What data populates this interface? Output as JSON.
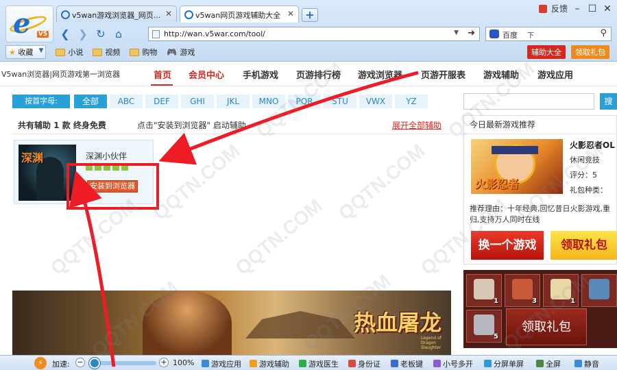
{
  "browser": {
    "tabs": [
      {
        "label": "v5wan游戏浏览器_网页..."
      },
      {
        "label": "v5wan网页游戏辅助大全"
      }
    ],
    "new_tab_label": "+",
    "feedback": "反馈",
    "logo_badge": "V5",
    "address": "http://wan.v5war.com/tool/",
    "search_engine": "百度",
    "favorites_label": "收藏",
    "favorites": [
      {
        "label": "小说"
      },
      {
        "label": "视频"
      },
      {
        "label": "购物"
      },
      {
        "label": "游戏"
      }
    ],
    "helpers_button": "辅助大全",
    "gift_button": "领取礼包"
  },
  "site": {
    "brand": "V5wan浏览器|网页游戏第一浏览器",
    "nav": [
      {
        "label": "首页"
      },
      {
        "label": "会员中心"
      },
      {
        "label": "手机游戏"
      },
      {
        "label": "页游排行榜"
      },
      {
        "label": "游戏浏览器"
      },
      {
        "label": "页游开服表"
      },
      {
        "label": "游戏辅助"
      },
      {
        "label": "游戏应用"
      }
    ],
    "filter_label": "按首字母:",
    "letters": [
      "全部",
      "ABC",
      "DEF",
      "GHI",
      "JKL",
      "MNO",
      "PQR",
      "STU",
      "VWX",
      "YZ"
    ],
    "search_btn": "搜"
  },
  "helper_list": {
    "count_text": "共有辅助 1 款 终身免费",
    "hint_text": "点击\"安装到浏览器\" 启动辅助",
    "expand_link": "展开全部辅助",
    "items": [
      {
        "thumb_title": "深渊",
        "name": "深渊小伙伴",
        "rating": 5,
        "install_label": "安装到浏览器"
      }
    ]
  },
  "banner": {
    "title": "热血屠龙",
    "subtitle": "Legend of Dragon Slaughter"
  },
  "today": {
    "title": "今日最新游戏推荐",
    "game_name": "火影忍者OL",
    "thumb_logo": "火影忍者",
    "genre": "休闲竞技",
    "score": "评分：5",
    "gift": "礼包种类：",
    "reason": "推荐理由：十年经典,回忆昔日火影游戏,重归,支持万人同时在线",
    "btn_another": "换一个游戏",
    "btn_claim": "领取礼包"
  },
  "gift_panel": {
    "slots": [
      {
        "num": "1",
        "color": "#d8c8b8"
      },
      {
        "num": "3",
        "color": "#c85a3a"
      },
      {
        "num": "1",
        "color": "#e8d8a8"
      },
      {
        "num": "",
        "color": "#5a8ab8"
      },
      {
        "num": "5",
        "color": "#b8b8c0"
      }
    ],
    "claim_label": "领取礼包"
  },
  "status_bar": {
    "speed_icon": "⚡",
    "speed_label": "加速:",
    "zoom_minus": "−",
    "zoom_plus": "+",
    "zoom_level": "100%",
    "items": [
      {
        "label": "游戏应用",
        "color": "#3a8ad8"
      },
      {
        "label": "游戏辅助",
        "color": "#f0a01c"
      },
      {
        "label": "游戏医生",
        "color": "#2ab04a"
      },
      {
        "label": "身份证",
        "color": "#d84a3a"
      },
      {
        "label": "老板键",
        "color": "#3a6ad8"
      },
      {
        "label": "小号多开",
        "color": "#8a5ad8"
      },
      {
        "label": "分屏单屏",
        "color": "#2a9ad8"
      },
      {
        "label": "全屏",
        "color": "#4a8a3a"
      },
      {
        "label": "静音",
        "color": "#3a8ad8"
      }
    ]
  },
  "watermark": "QQTN.COM",
  "colors": {
    "accent_blue": "#29a0d8",
    "accent_red": "#d7261e",
    "annotation_red": "#ee1c24"
  }
}
